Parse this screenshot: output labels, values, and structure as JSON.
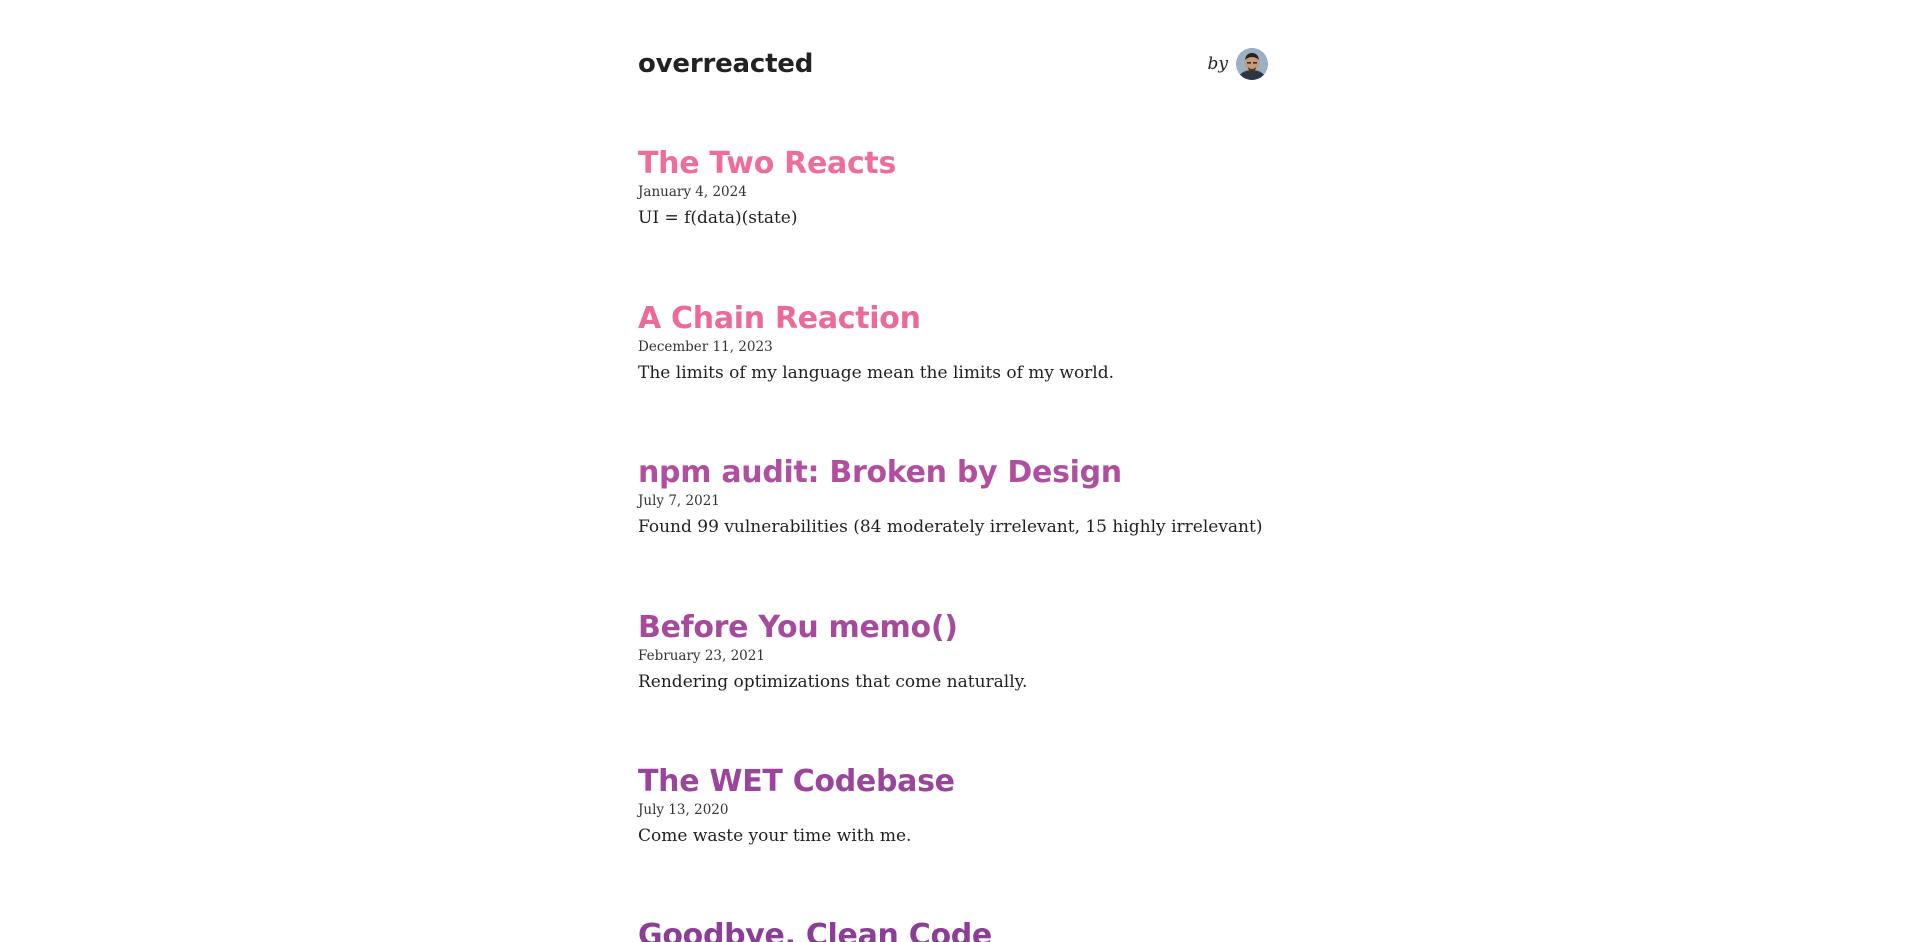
{
  "site": {
    "title": "overreacted",
    "by_label": "by"
  },
  "posts": [
    {
      "title": "The Two Reacts",
      "date": "January 4, 2024",
      "spoiler": "UI = f(data)(state)",
      "color": "#ee6d9b"
    },
    {
      "title": "A Chain Reaction",
      "date": "December 11, 2023",
      "spoiler": "The limits of my language mean the limits of my world.",
      "color": "#ea6a9a"
    },
    {
      "title": "npm audit: Broken by Design",
      "date": "July 7, 2021",
      "spoiler": "Found 99 vulnerabilities (84 moderately irrelevant, 15 highly irrelevant)",
      "color": "#b24ea0"
    },
    {
      "title": "Before You memo()",
      "date": "February 23, 2021",
      "spoiler": "Rendering optimizations that come naturally.",
      "color": "#a64a9e"
    },
    {
      "title": "The WET Codebase",
      "date": "July 13, 2020",
      "spoiler": "Come waste your time with me.",
      "color": "#9a449c"
    },
    {
      "title": "Goodbye, Clean Code",
      "date": "",
      "spoiler": "",
      "color": "#8b3d98"
    }
  ]
}
